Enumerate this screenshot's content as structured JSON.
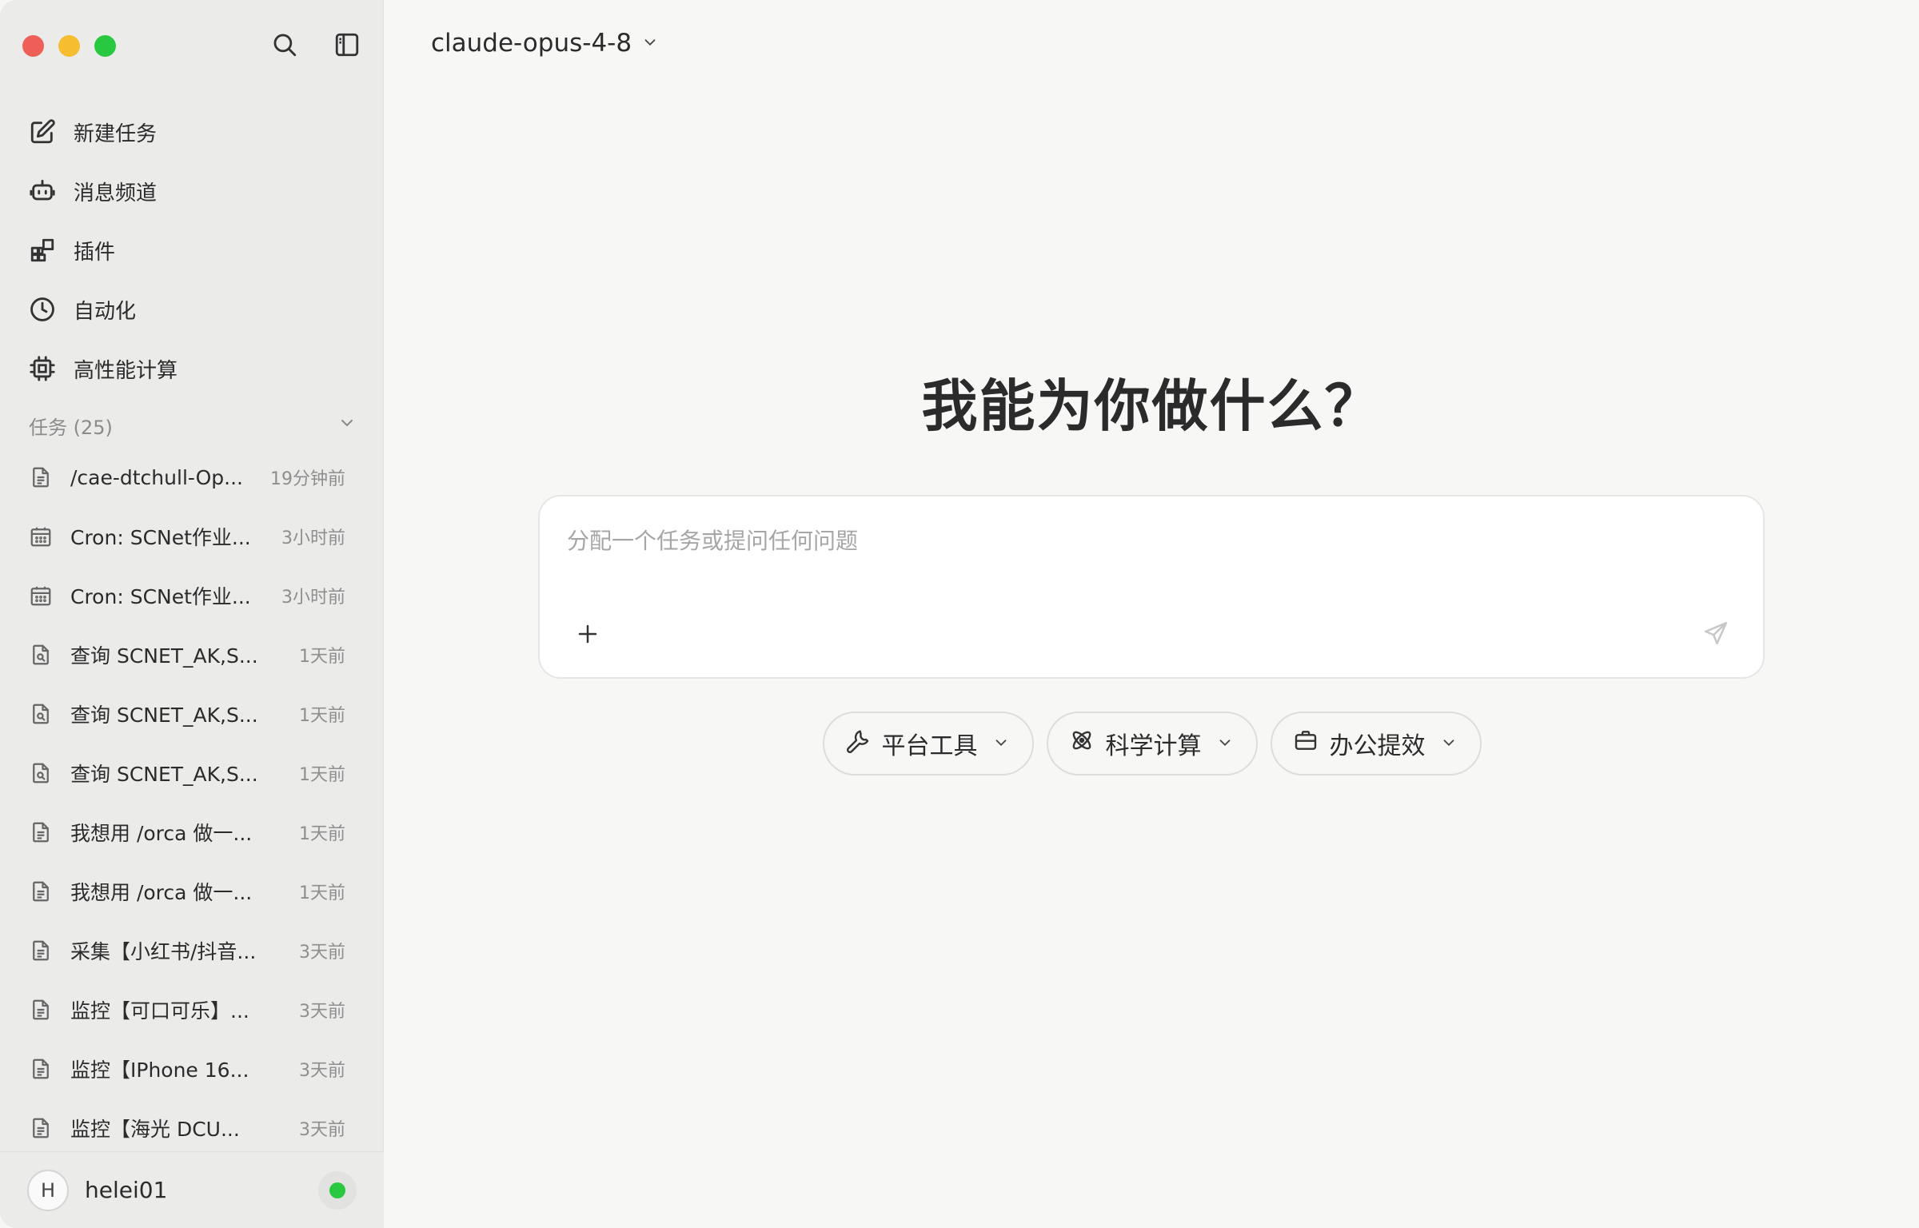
{
  "window": {
    "traffic_lights": [
      "close",
      "minimize",
      "maximize"
    ]
  },
  "sidebar": {
    "top_icons": [
      "search-icon",
      "sidebar-toggle-icon"
    ],
    "nav": [
      {
        "label": "新建任务",
        "icon": "edit-icon"
      },
      {
        "label": "消息频道",
        "icon": "bot-icon"
      },
      {
        "label": "插件",
        "icon": "plugin-icon"
      },
      {
        "label": "自动化",
        "icon": "clock-icon"
      },
      {
        "label": "高性能计算",
        "icon": "cpu-icon"
      }
    ],
    "tasks_header": "任务 (25)",
    "tasks": [
      {
        "title": "/cae-dtchull-Op...",
        "time": "19分钟前",
        "icon": "document-icon"
      },
      {
        "title": "Cron: SCNet作业...",
        "time": "3小时前",
        "icon": "calendar-icon"
      },
      {
        "title": "Cron: SCNet作业...",
        "time": "3小时前",
        "icon": "calendar-icon"
      },
      {
        "title": "查询 SCNET_AK,S...",
        "time": "1天前",
        "icon": "document-search-icon"
      },
      {
        "title": "查询 SCNET_AK,S...",
        "time": "1天前",
        "icon": "document-search-icon"
      },
      {
        "title": "查询 SCNET_AK,S...",
        "time": "1天前",
        "icon": "document-search-icon"
      },
      {
        "title": "我想用 /orca 做一...",
        "time": "1天前",
        "icon": "document-icon"
      },
      {
        "title": "我想用 /orca 做一...",
        "time": "1天前",
        "icon": "document-icon"
      },
      {
        "title": "采集【小红书/抖音...",
        "time": "3天前",
        "icon": "document-icon"
      },
      {
        "title": "监控【可口可乐】...",
        "time": "3天前",
        "icon": "document-icon"
      },
      {
        "title": "监控【IPhone 16...",
        "time": "3天前",
        "icon": "document-icon"
      },
      {
        "title": "监控【海光 DCU...",
        "time": "3天前",
        "icon": "document-icon"
      }
    ],
    "user": {
      "initial": "H",
      "name": "helei01",
      "status_color": "#28c840"
    }
  },
  "main": {
    "model": "claude-opus-4-8",
    "hero": "我能为你做什么？",
    "composer": {
      "placeholder": "分配一个任务或提问任何问题"
    },
    "chips": [
      {
        "label": "平台工具",
        "icon": "wrench-icon"
      },
      {
        "label": "科学计算",
        "icon": "atom-icon"
      },
      {
        "label": "办公提效",
        "icon": "briefcase-icon"
      }
    ]
  }
}
